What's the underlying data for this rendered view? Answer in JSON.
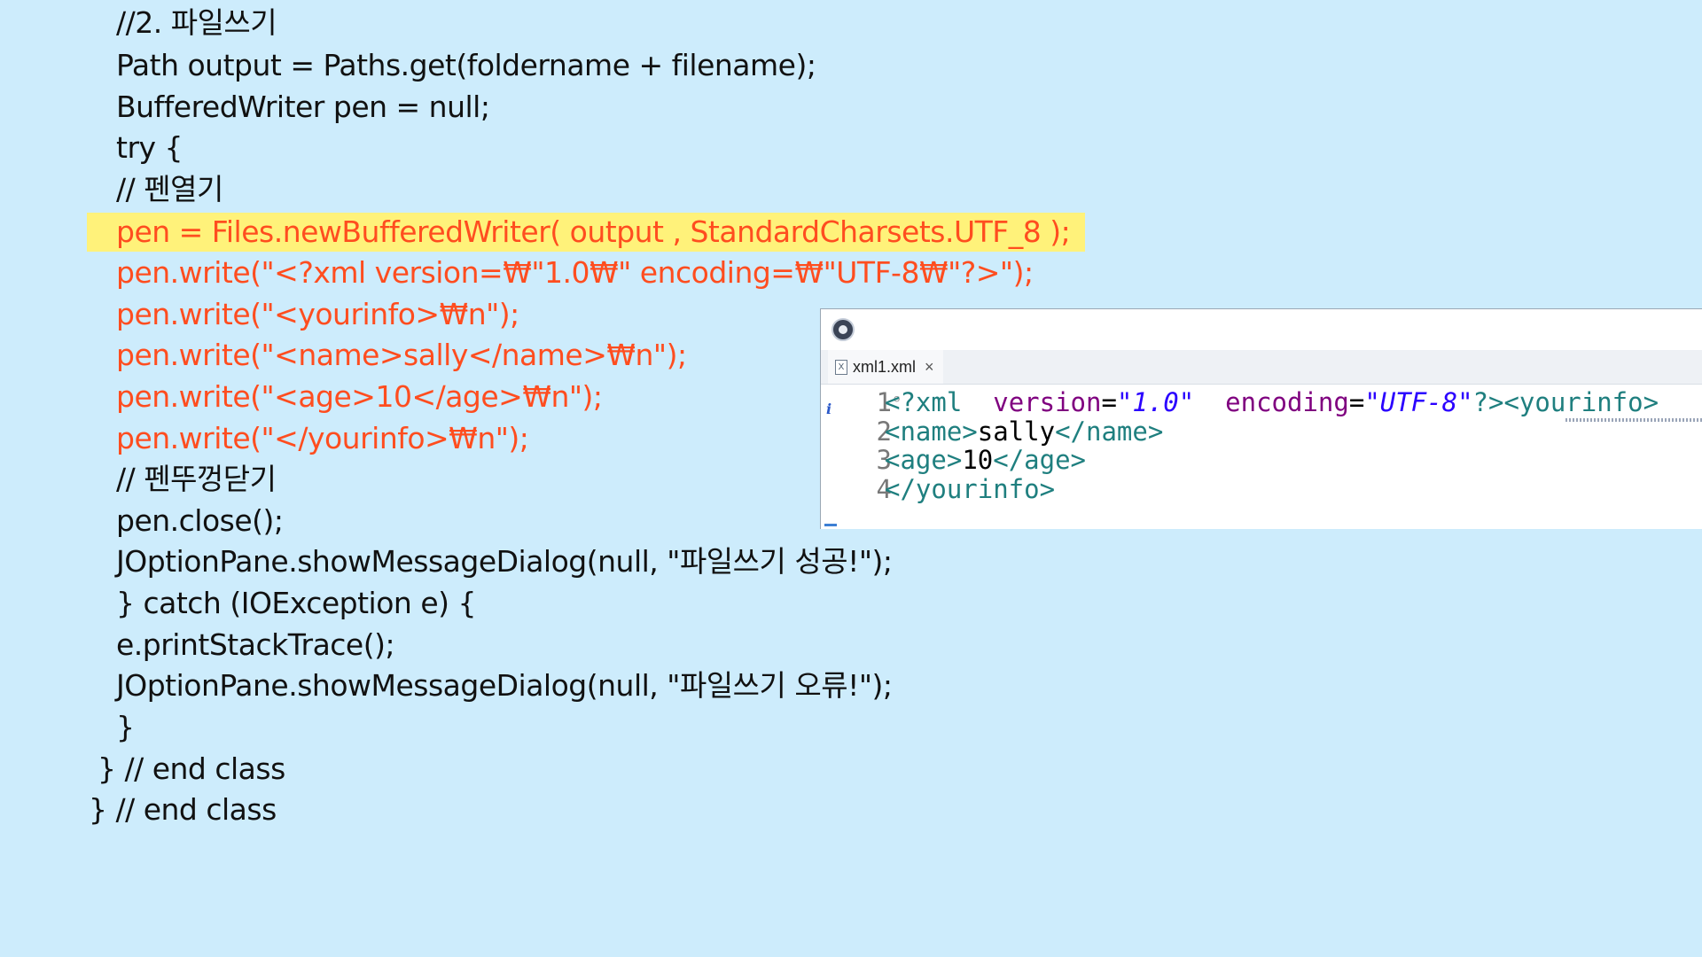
{
  "code": {
    "lines": [
      "//2. 파일쓰기",
      "Path output = Paths.get(foldername + filename);",
      "BufferedWriter pen = null;",
      "try {",
      "// 펜열기",
      "pen = Files.newBufferedWriter( output , StandardCharsets.UTF_8 );",
      "pen.write(\"<?xml version=₩\"1.0₩\" encoding=₩\"UTF-8₩\"?>\");",
      "pen.write(\"<yourinfo>₩n\");",
      "pen.write(\"<name>sally</name>₩n\");",
      "pen.write(\"<age>10</age>₩n\");",
      "pen.write(\"</yourinfo>₩n\");",
      "// 펜뚜껑닫기",
      "pen.close();",
      "JOptionPane.showMessageDialog(null, \"파일쓰기 성공!\");",
      "} catch (IOException e) {",
      "e.printStackTrace();",
      "JOptionPane.showMessageDialog(null, \"파일쓰기 오류!\");",
      "}",
      "} // end class",
      "} // end class"
    ]
  },
  "colors": {
    "background": "#cdecfc",
    "code_text": "#111111",
    "highlight_text": "#ff4d1f",
    "highlight_bg": "#fff27a"
  },
  "editor": {
    "app_icon": "eclipse-icon",
    "tab": {
      "filename": "xml1.xml",
      "close": "×",
      "file_icon": "X"
    },
    "gutter_marker": "i",
    "lines": [
      {
        "num": "1",
        "fold": "⊖",
        "parts": [
          {
            "k": "tag",
            "t": "<?xml"
          },
          {
            "k": "txt",
            "t": "  "
          },
          {
            "k": "attr",
            "t": "version"
          },
          {
            "k": "txt",
            "t": "="
          },
          {
            "k": "val",
            "t": "\"1.0\""
          },
          {
            "k": "txt",
            "t": "  "
          },
          {
            "k": "attr",
            "t": "encoding"
          },
          {
            "k": "txt",
            "t": "="
          },
          {
            "k": "val",
            "t": "\"UTF-8\""
          },
          {
            "k": "tag",
            "t": "?><yourinfo>"
          }
        ]
      },
      {
        "num": "2",
        "fold": "",
        "parts": [
          {
            "k": "tag",
            "t": "<name>"
          },
          {
            "k": "txt",
            "t": "sally"
          },
          {
            "k": "tag",
            "t": "</name>"
          }
        ]
      },
      {
        "num": "3",
        "fold": "",
        "parts": [
          {
            "k": "tag",
            "t": "<age>"
          },
          {
            "k": "txt",
            "t": "10"
          },
          {
            "k": "tag",
            "t": "</age>"
          }
        ]
      },
      {
        "num": "4",
        "fold": "",
        "parts": [
          {
            "k": "tag",
            "t": "</yourinfo>"
          }
        ]
      }
    ]
  }
}
